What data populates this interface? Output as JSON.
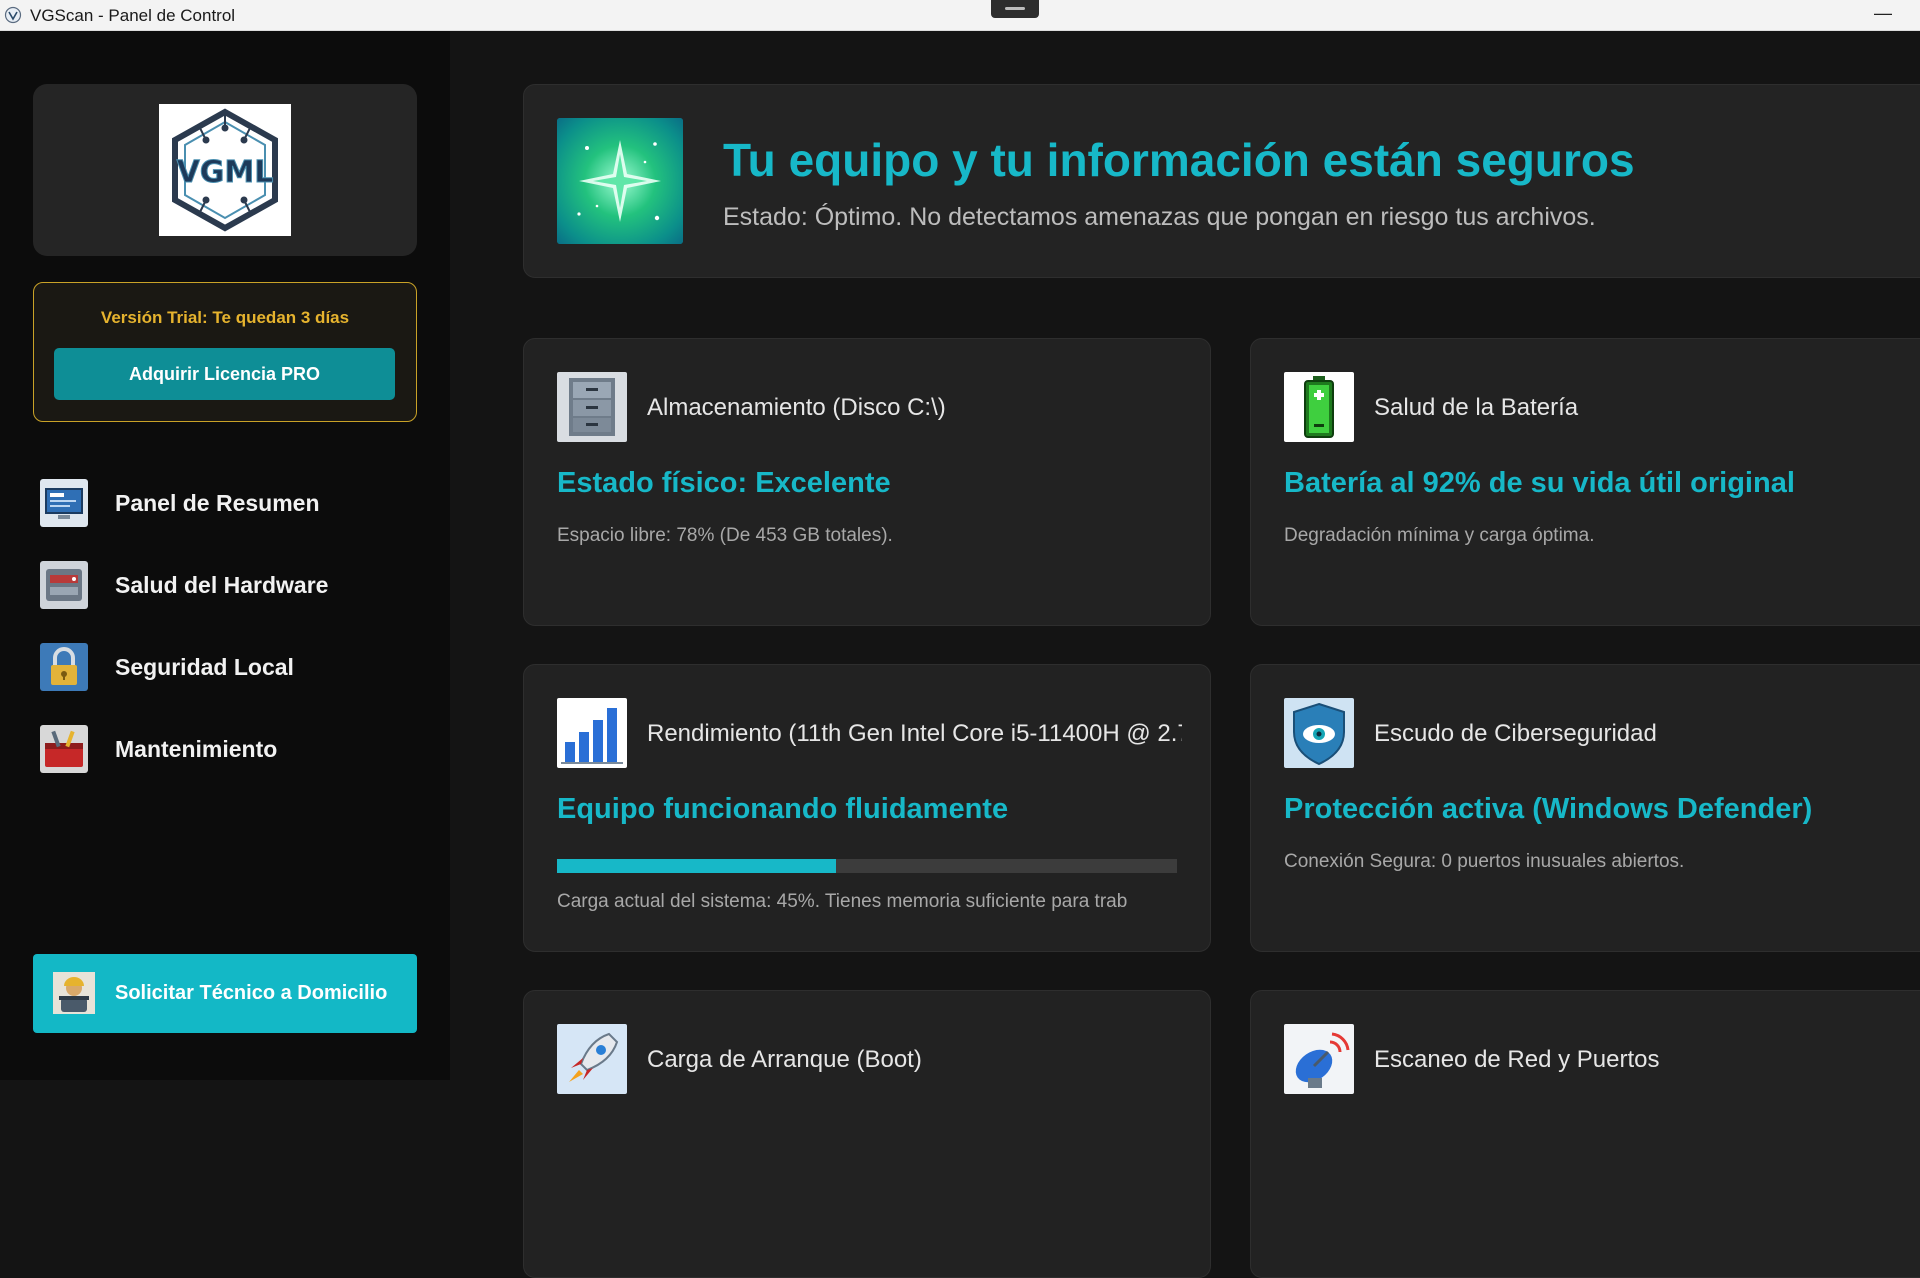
{
  "window": {
    "title": "VGScan - Panel de Control",
    "minimize": "—"
  },
  "sidebar": {
    "trial_text": "Versión Trial: Te quedan 3 días",
    "buy_label": "Adquirir Licencia PRO",
    "nav": [
      {
        "label": "Panel de Resumen",
        "icon": "monitor-icon"
      },
      {
        "label": "Salud del Hardware",
        "icon": "hardware-icon"
      },
      {
        "label": "Seguridad Local",
        "icon": "lock-icon"
      },
      {
        "label": "Mantenimiento",
        "icon": "toolbox-icon"
      }
    ],
    "tech_button": "Solicitar Técnico a Domicilio"
  },
  "hero": {
    "title": "Tu equipo y tu información están seguros",
    "subtitle": "Estado: Óptimo. No detectamos amenazas que pongan en riesgo tus archivos."
  },
  "cards": [
    {
      "title": "Almacenamiento (Disco C:\\)",
      "status": "Estado físico: Excelente",
      "detail": "Espacio libre: 78% (De 453 GB totales).",
      "icon": "filing-cabinet-icon"
    },
    {
      "title": "Salud de la Batería",
      "status": "Batería al 92% de su vida útil original",
      "detail": "Degradación mínima y carga óptima.",
      "icon": "battery-icon"
    },
    {
      "title": "Rendimiento (11th Gen Intel Core i5-11400H @ 2.7",
      "status": "Equipo funcionando fluidamente",
      "detail": "Carga actual del sistema: 45%. Tienes memoria suficiente para trab",
      "icon": "bar-chart-icon",
      "progress": 0.45
    },
    {
      "title": "Escudo de Ciberseguridad",
      "status": "Protección activa (Windows Defender)",
      "detail": "Conexión Segura: 0 puertos inusuales abiertos.",
      "icon": "shield-eye-icon"
    },
    {
      "title": "Carga de Arranque (Boot)",
      "icon": "rocket-icon"
    },
    {
      "title": "Escaneo de Red y Puertos",
      "icon": "satellite-dish-icon"
    }
  ],
  "colors": {
    "accent": "#17b8c8",
    "trial": "#e6b32e",
    "button": "#0e8e96"
  }
}
